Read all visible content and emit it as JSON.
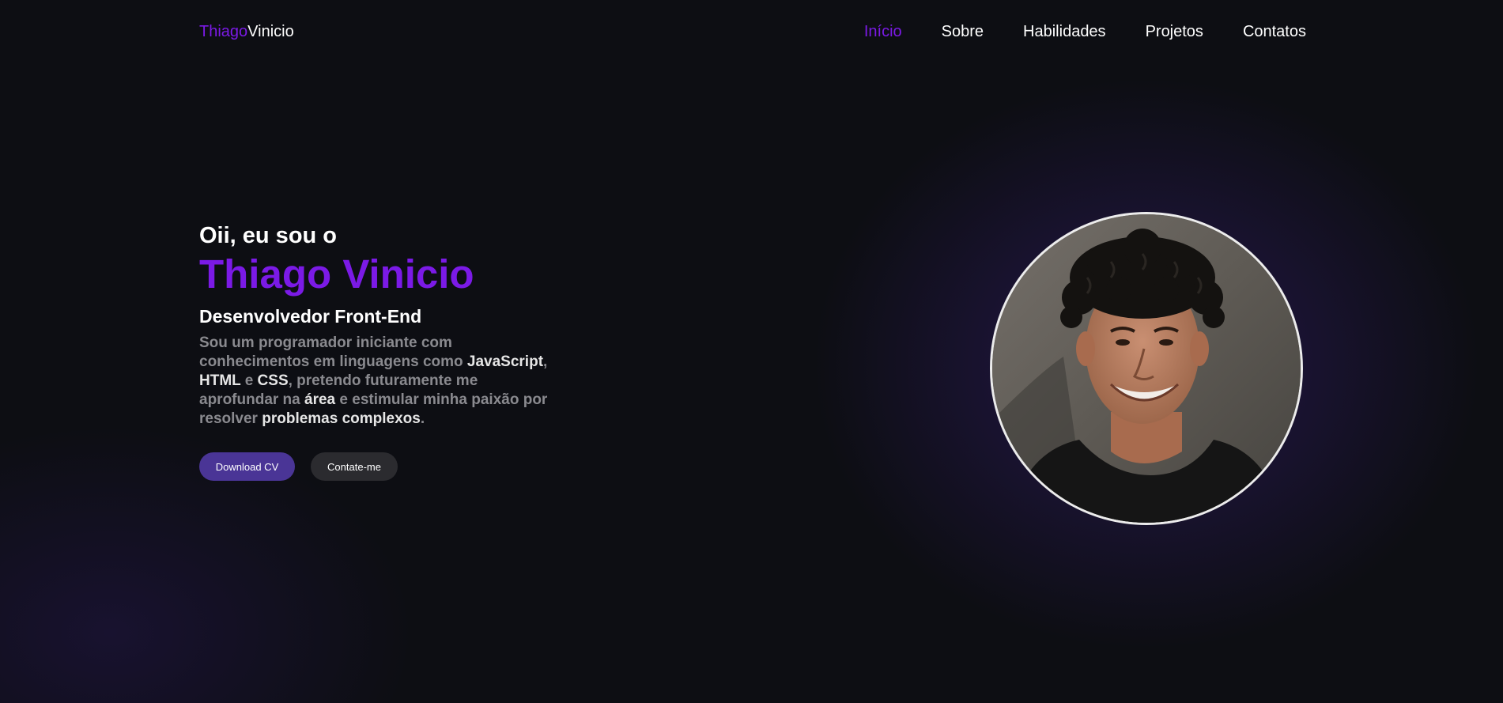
{
  "nav": {
    "logo_first": "Thiago",
    "logo_last": "Vinicio",
    "links": [
      {
        "label": "Início",
        "active": true
      },
      {
        "label": "Sobre",
        "active": false
      },
      {
        "label": "Habilidades",
        "active": false
      },
      {
        "label": "Projetos",
        "active": false
      },
      {
        "label": "Contatos",
        "active": false
      }
    ]
  },
  "hero": {
    "greeting": "Oii, eu sou o",
    "name": "Thiago Vinicio",
    "role": "Desenvolvedor Front-End",
    "bio": {
      "p1": "Sou um programador iniciante com conhecimentos em linguagens como ",
      "h1": "JavaScript",
      "p2": ", ",
      "h2": "HTML",
      "p3": " e ",
      "h3": "CSS",
      "p4": ", pretendo futuramente me aprofundar na ",
      "h4": "área",
      "p5": " e estimular minha paixão por resolver ",
      "h5": "problemas complexos",
      "p6": "."
    },
    "buttons": {
      "download": "Download CV",
      "contact": "Contate-me"
    }
  },
  "colors": {
    "accent": "#7b1ae6",
    "background": "#0d0e13",
    "primary_button": "#4a3596",
    "secondary_button": "#2b2b2f"
  }
}
